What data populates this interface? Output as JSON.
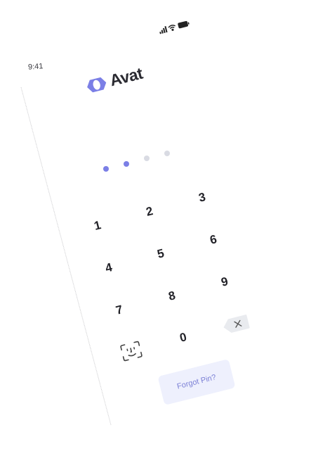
{
  "status_bar": {
    "time": "9:41"
  },
  "brand": {
    "name": "Avat",
    "accent": "#7b7fe6"
  },
  "pin": {
    "entered": 2,
    "length": 4,
    "filled_color": "#7b7fe6",
    "empty_color": "#d9dbe3"
  },
  "keypad": {
    "keys": [
      "1",
      "2",
      "3",
      "4",
      "5",
      "6",
      "7",
      "8",
      "9",
      "0"
    ]
  },
  "actions": {
    "forgot_label": "Forgot Pin?"
  }
}
